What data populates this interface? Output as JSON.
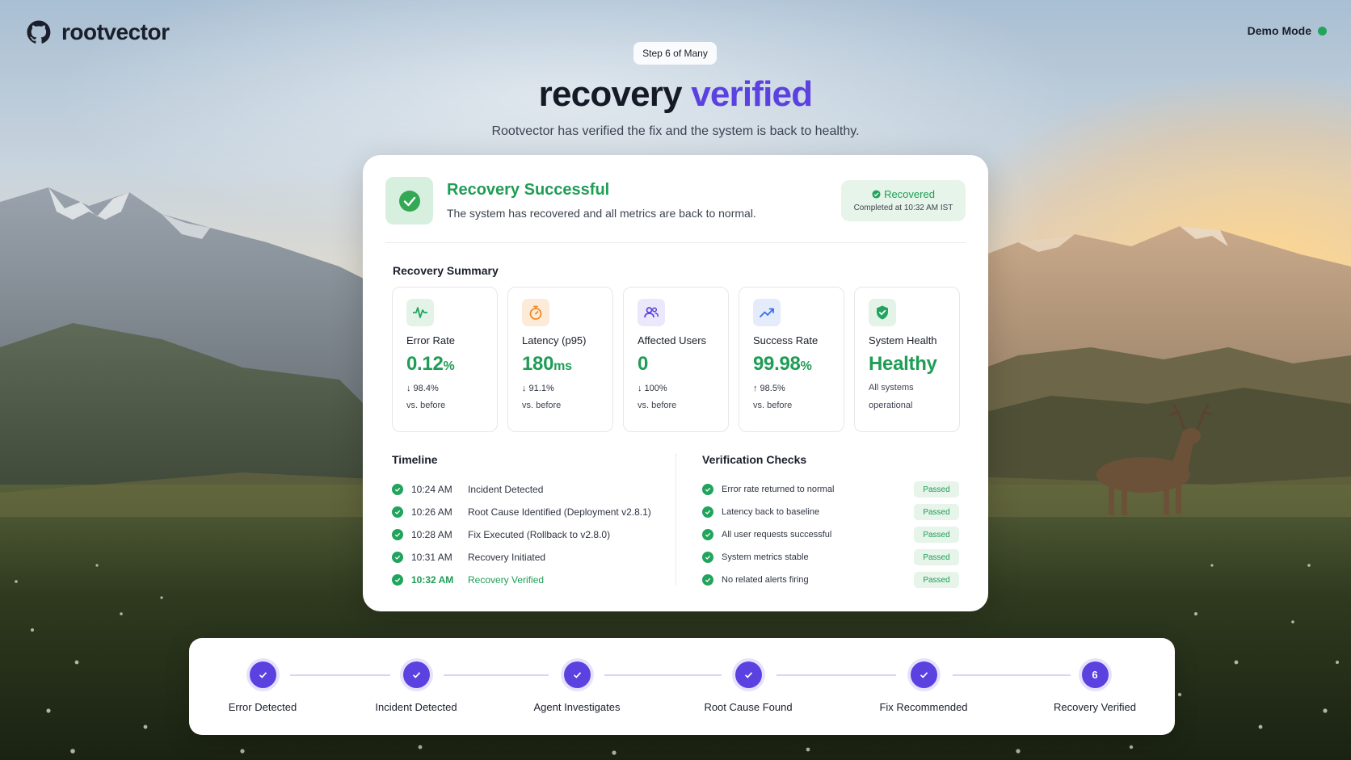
{
  "brand": {
    "name": "rootvector",
    "logo_icon": "github-icon"
  },
  "header": {
    "demo_mode_label": "Demo Mode",
    "demo_status_color": "#22a45d"
  },
  "step_pill": "Step 6 of Many",
  "hero": {
    "title_main": "recovery",
    "title_accent": "verified",
    "subtitle": "Rootvector has verified the fix and the system is back to healthy."
  },
  "status": {
    "title": "Recovery Successful",
    "description": "The system has recovered and all metrics are back to normal.",
    "badge_label": "Recovered",
    "badge_time": "Completed at 10:32 AM IST"
  },
  "summary": {
    "heading": "Recovery Summary",
    "metrics": [
      {
        "label": "Error Rate",
        "value": "0.12",
        "unit": "%",
        "delta": "↓ 98.4%",
        "note": "vs. before",
        "icon": "activity-icon"
      },
      {
        "label": "Latency (p95)",
        "value": "180",
        "unit": "ms",
        "delta": "↓ 91.1%",
        "note": "vs. before",
        "icon": "stopwatch-icon"
      },
      {
        "label": "Affected Users",
        "value": "0",
        "unit": "",
        "delta": "↓ 100%",
        "note": "vs. before",
        "icon": "users-icon"
      },
      {
        "label": "Success Rate",
        "value": "99.98",
        "unit": "%",
        "delta": "↑ 98.5%",
        "note": "vs. before",
        "icon": "trending-up-icon"
      },
      {
        "label": "System Health",
        "value": "Healthy",
        "unit": "",
        "delta": "",
        "note": "All systems operational",
        "icon": "shield-check-icon"
      }
    ]
  },
  "timeline": {
    "heading": "Timeline",
    "items": [
      {
        "time": "10:24 AM",
        "event": "Incident Detected"
      },
      {
        "time": "10:26 AM",
        "event": "Root Cause Identified (Deployment v2.8.1)"
      },
      {
        "time": "10:28 AM",
        "event": "Fix Executed (Rollback to v2.8.0)"
      },
      {
        "time": "10:31 AM",
        "event": "Recovery Initiated"
      },
      {
        "time": "10:32 AM",
        "event": "Recovery Verified"
      }
    ]
  },
  "verification": {
    "heading": "Verification Checks",
    "items": [
      {
        "text": "Error rate returned to normal",
        "status": "Passed"
      },
      {
        "text": "Latency back to baseline",
        "status": "Passed"
      },
      {
        "text": "All user requests successful",
        "status": "Passed"
      },
      {
        "text": "System metrics stable",
        "status": "Passed"
      },
      {
        "text": "No related alerts firing",
        "status": "Passed"
      }
    ]
  },
  "progress": {
    "steps": [
      {
        "label": "Error Detected",
        "marker": ""
      },
      {
        "label": "Incident Detected",
        "marker": ""
      },
      {
        "label": "Agent Investigates",
        "marker": ""
      },
      {
        "label": "Root Cause Found",
        "marker": ""
      },
      {
        "label": "Fix Recommended",
        "marker": ""
      },
      {
        "label": "Recovery Verified",
        "marker": "6"
      }
    ]
  },
  "colors": {
    "accent": "#5b41e0",
    "success": "#1f9d55",
    "success_bg": "#e6f4ea"
  }
}
